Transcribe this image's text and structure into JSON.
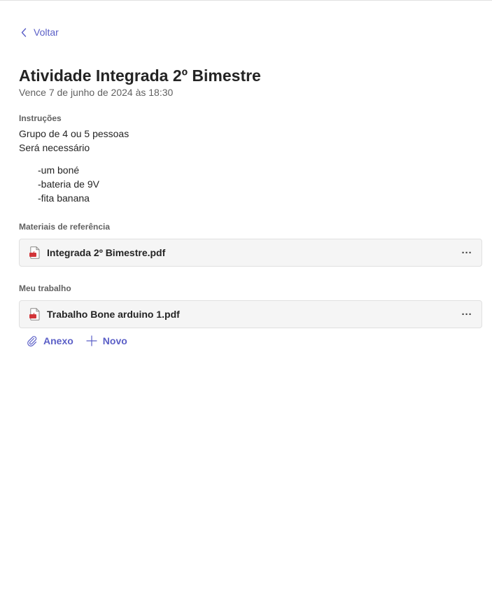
{
  "back_label": "Voltar",
  "assignment": {
    "title": "Atividade Integrada 2º Bimestre",
    "due": "Vence 7 de junho de 2024 às 18:30"
  },
  "instructions": {
    "label": "Instruções",
    "lines": [
      "Grupo de 4 ou 5 pessoas",
      "Será necessário"
    ],
    "list": [
      "-um boné",
      "-bateria de 9V",
      "-fita banana"
    ]
  },
  "reference": {
    "label": "Materiais de referência",
    "files": [
      {
        "name": "Integrada 2º Bimestre.pdf",
        "icon": "pdf-file-icon"
      }
    ]
  },
  "my_work": {
    "label": "Meu trabalho",
    "files": [
      {
        "name": "Trabalho Bone arduino 1.pdf",
        "icon": "pdf-file-icon"
      }
    ]
  },
  "actions": {
    "attach_label": "Anexo",
    "new_label": "Novo"
  },
  "more_glyph": "···",
  "colors": {
    "accent": "#5b5fc7",
    "pdf_icon": "#d13438",
    "card_bg": "#f5f5f5"
  }
}
